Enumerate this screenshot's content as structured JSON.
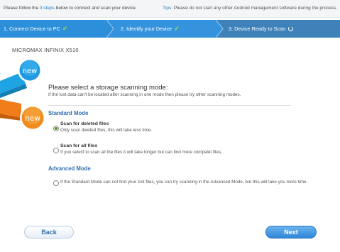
{
  "header": {
    "instruction_prefix": "Please follow the ",
    "instruction_steps": "3 steps",
    "instruction_suffix": " below to connect and scan your device.",
    "tips_label": "Tips:",
    "tips_text": " Please do not start any other Android management software during the process."
  },
  "steps": [
    {
      "label": "1. Connect Device to PC",
      "status": "done"
    },
    {
      "label": "2. Identify your Device",
      "status": "done"
    },
    {
      "label": "3. Device Ready to Scan",
      "status": "in-progress"
    }
  ],
  "device_name": "MICROMAX INFINIX X510",
  "badges": {
    "top": "new",
    "bottom": "new"
  },
  "scan": {
    "prompt": "Please select a storage scanning mode:",
    "hint": "If the lost data can't be located after scanning in one mode then please try other scanning modes.",
    "standard_title": "Standard Mode",
    "options": [
      {
        "title": "Scan for deleted files",
        "desc": "Only scan deleted files, this will take less time.",
        "selected": true
      },
      {
        "title": "Scan for all files",
        "desc": "If you select to scan all the files it will take longer but can find more compelet files.",
        "selected": false
      }
    ],
    "advanced_title": "Advanced Mode",
    "advanced_option": {
      "desc": "If the Standard Mode can not find your lost files, you can try scanning in the Advanced Mode, but this will take you more time.",
      "selected": false
    }
  },
  "buttons": {
    "back": "Back",
    "next": "Next"
  },
  "colors": {
    "step_done": "#2d8fd9",
    "step_active": "#3f82b9",
    "ribbon_blue": "#1ea3e3",
    "ribbon_orange": "#f07c1a",
    "accent": "#2f6fb0",
    "check": "#8ee04e"
  }
}
